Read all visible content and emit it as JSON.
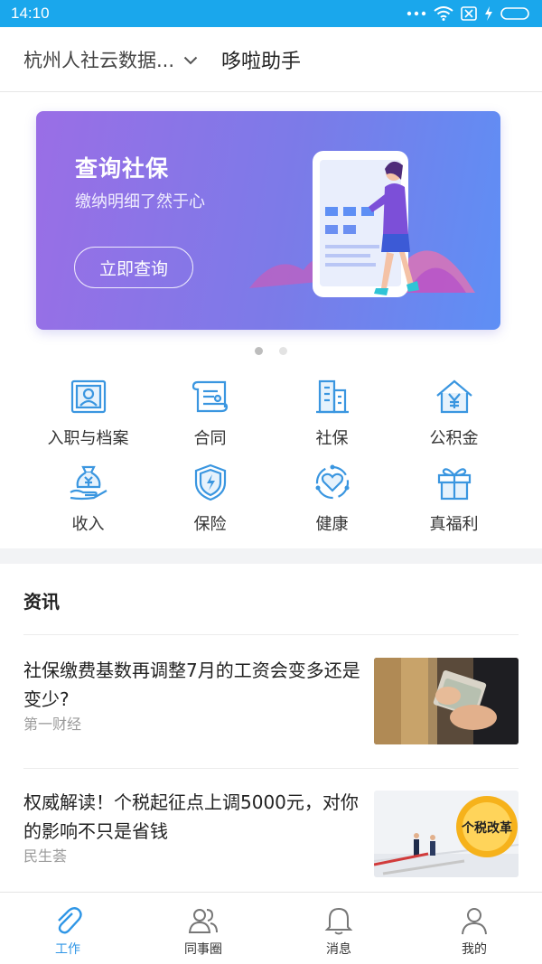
{
  "status_bar": {
    "time": "14:10"
  },
  "header": {
    "org_name": "杭州人社云数据...",
    "app_title": "哆啦助手"
  },
  "banner": {
    "title": "查询社保",
    "subtitle": "缴纳明细了然于心",
    "button_label": "立即查询"
  },
  "services": [
    {
      "label": "入职与档案",
      "icon": "profile-card-icon"
    },
    {
      "label": "合同",
      "icon": "contract-scroll-icon"
    },
    {
      "label": "社保",
      "icon": "building-icon"
    },
    {
      "label": "公积金",
      "icon": "house-yen-icon"
    },
    {
      "label": "收入",
      "icon": "money-bag-hand-icon"
    },
    {
      "label": "保险",
      "icon": "shield-icon"
    },
    {
      "label": "健康",
      "icon": "heart-icon"
    },
    {
      "label": "真福利",
      "icon": "gift-icon"
    }
  ],
  "news": {
    "heading": "资讯",
    "items": [
      {
        "title": "社保缴费基数再调整7月的工资会变多还是变少?",
        "source": "第一财经"
      },
      {
        "title": "权威解读！个税起征点上调5000元，对你的影响不只是省钱",
        "source": "民生荟",
        "image_text": "个税改革"
      }
    ]
  },
  "tabbar": [
    {
      "label": "工作",
      "icon": "paperclip-icon",
      "active": true
    },
    {
      "label": "同事圈",
      "icon": "colleagues-icon",
      "active": false
    },
    {
      "label": "消息",
      "icon": "bell-icon",
      "active": false
    },
    {
      "label": "我的",
      "icon": "person-icon",
      "active": false
    }
  ],
  "colors": {
    "accent": "#2f96e6",
    "status_bar": "#1aa7ec",
    "banner_start": "#9a6ee6",
    "banner_end": "#5e8ff5"
  }
}
